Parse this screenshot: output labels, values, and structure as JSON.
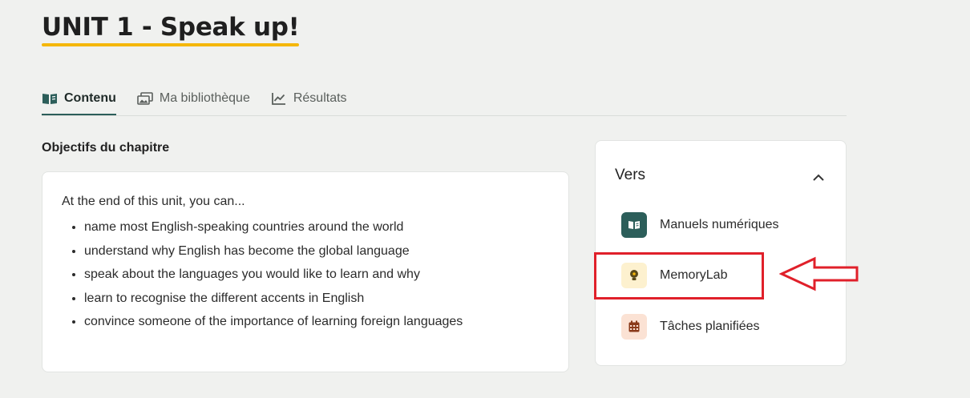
{
  "header": {
    "title": "UNIT 1 - Speak up!"
  },
  "tabs": [
    {
      "label": "Contenu",
      "icon": "book-open-icon",
      "active": true
    },
    {
      "label": "Ma bibliothèque",
      "icon": "images-icon",
      "active": false
    },
    {
      "label": "Résultats",
      "icon": "chart-line-icon",
      "active": false
    }
  ],
  "objectives": {
    "title": "Objectifs du chapitre",
    "intro": "At the end of this unit, you can...",
    "items": [
      "name most English-speaking countries around the world",
      "understand why English has become the global language",
      "speak about the languages you would like to learn and why",
      "learn to recognise the different accents in English",
      "convince someone of the importance of learning foreign languages"
    ]
  },
  "sidebar": {
    "title": "Vers",
    "items": [
      {
        "label": "Manuels numériques",
        "icon": "book-icon",
        "badge_color": "#2c5e5a"
      },
      {
        "label": "MemoryLab",
        "icon": "brain-bulb-icon",
        "badge_color": "#fdf1cf"
      },
      {
        "label": "Tâches planifiées",
        "icon": "calendar-icon",
        "badge_color": "#fbe2d4"
      }
    ]
  },
  "colors": {
    "accent_yellow": "#f5b70a",
    "tab_active": "#2c5e5a",
    "highlight_red": "#e0202a"
  }
}
